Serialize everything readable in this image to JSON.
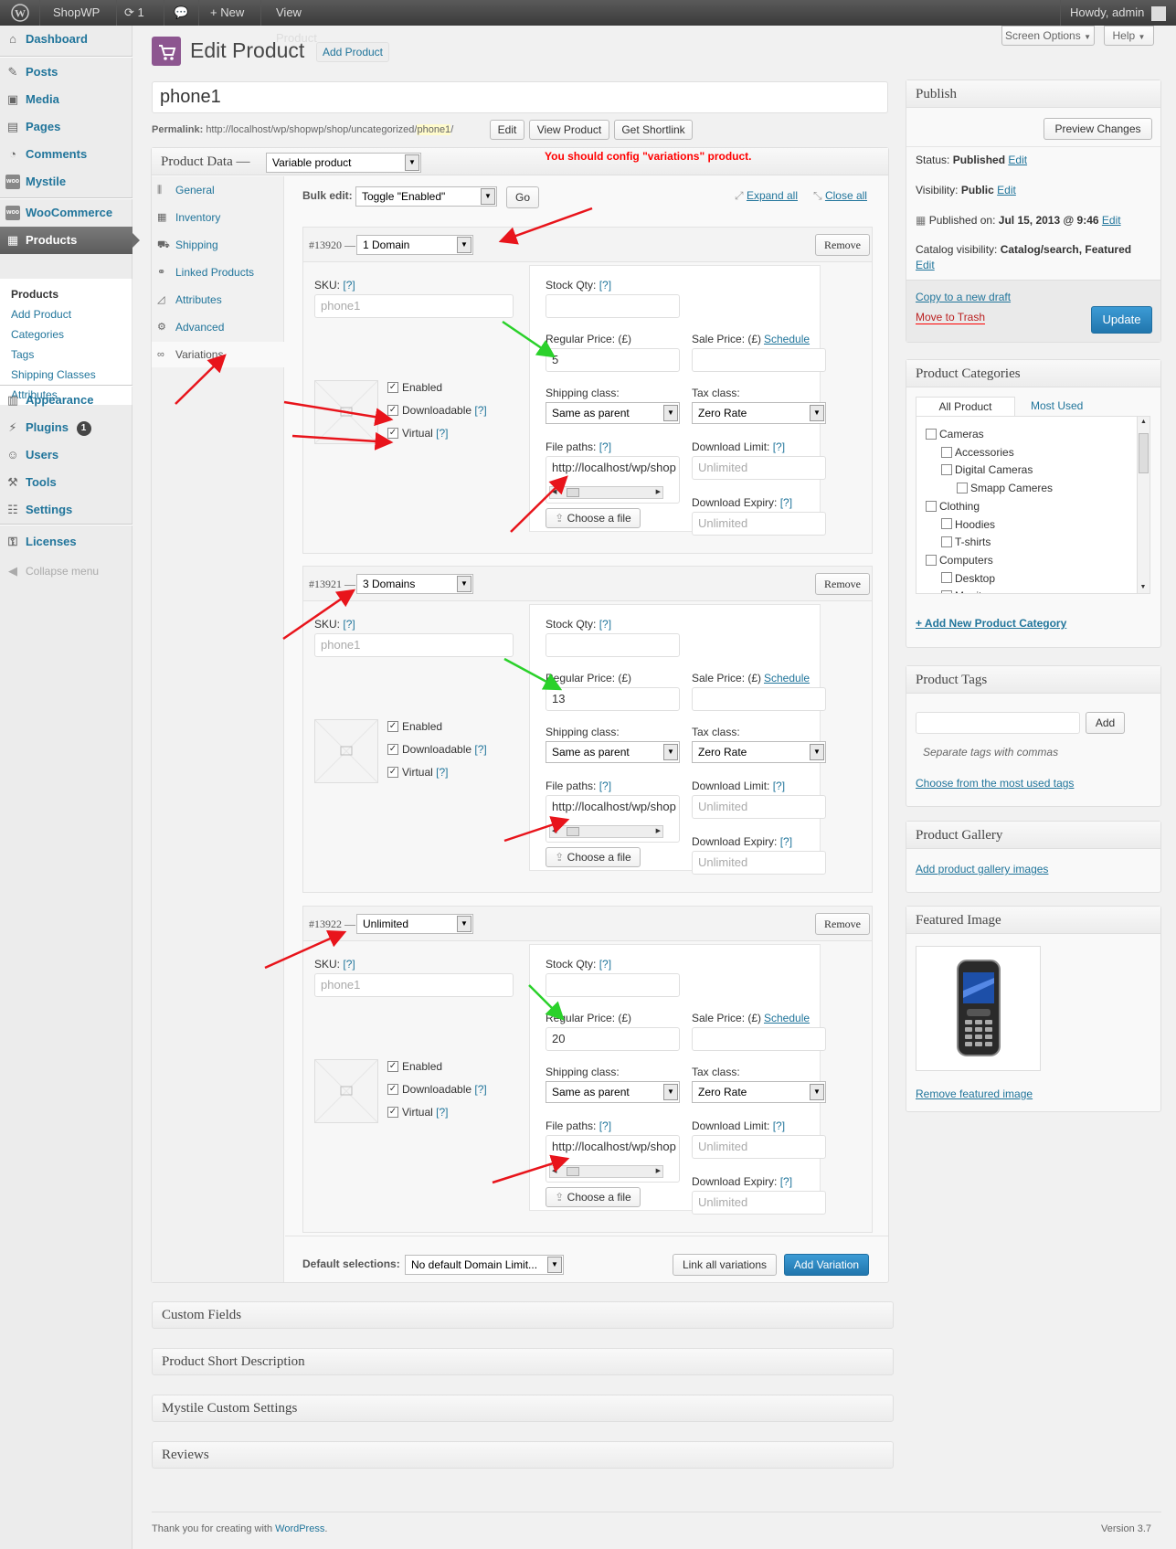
{
  "adminbar": {
    "site_name": "ShopWP",
    "updates_count": "1",
    "new_label": "New",
    "view_product": "View Product",
    "howdy": "Howdy, admin"
  },
  "sidebar": {
    "items": [
      {
        "label": "Dashboard",
        "icon": "dashboard-icon"
      },
      {
        "label": "Posts",
        "icon": "pin-icon"
      },
      {
        "label": "Media",
        "icon": "media-icon"
      },
      {
        "label": "Pages",
        "icon": "page-icon"
      },
      {
        "label": "Comments",
        "icon": "comment-icon"
      },
      {
        "label": "Mystile",
        "icon": "woo-icon"
      },
      {
        "label": "WooCommerce",
        "icon": "woo-icon"
      },
      {
        "label": "Products",
        "icon": "products-icon"
      },
      {
        "label": "Appearance",
        "icon": "appearance-icon"
      },
      {
        "label": "Plugins",
        "icon": "plugin-icon",
        "badge": "1"
      },
      {
        "label": "Users",
        "icon": "users-icon"
      },
      {
        "label": "Tools",
        "icon": "tools-icon"
      },
      {
        "label": "Settings",
        "icon": "settings-icon"
      },
      {
        "label": "Licenses",
        "icon": "key-icon"
      },
      {
        "label": "Collapse menu",
        "icon": "collapse-icon"
      }
    ],
    "submenu": [
      "Products",
      "Add Product",
      "Categories",
      "Tags",
      "Shipping Classes",
      "Attributes"
    ]
  },
  "header": {
    "screen_options": "Screen Options",
    "help": "Help",
    "title": "Edit Product",
    "add_product": "Add Product"
  },
  "product": {
    "title": "phone1",
    "permalink_label": "Permalink:",
    "permalink_base": "http://localhost/wp/shopwp/shop/uncategorized/",
    "permalink_slug": "phone1",
    "permalink_end": "/",
    "edit_btn": "Edit",
    "view_btn": "View Product",
    "shortlink_btn": "Get Shortlink"
  },
  "product_data": {
    "label": "Product Data —",
    "type": "Variable product",
    "notice": "You should config \"variations\" product.",
    "tabs": [
      "General",
      "Inventory",
      "Shipping",
      "Linked Products",
      "Attributes",
      "Advanced",
      "Variations"
    ],
    "bulk_edit_label": "Bulk edit:",
    "bulk_edit_value": "Toggle \"Enabled\"",
    "go": "Go",
    "expand_all": "Expand all",
    "close_all": "Close all",
    "remove": "Remove",
    "labels": {
      "sku": "SKU:",
      "q": "[?]",
      "stock": "Stock Qty:",
      "regular_price": "Regular Price: (£)",
      "sale_price": "Sale Price: (£)",
      "schedule": "Schedule",
      "shipping_class": "Shipping class:",
      "tax_class": "Tax class:",
      "file_paths": "File paths:",
      "download_limit": "Download Limit:",
      "download_expiry": "Download Expiry:",
      "choose_file": "Choose a file",
      "enabled": "Enabled",
      "downloadable": "Downloadable",
      "virtual": "Virtual",
      "dash": "—"
    },
    "variations": [
      {
        "id": "#13920",
        "name": "1 Domain",
        "sku_placeholder": "phone1",
        "regular_price": "5",
        "shipping": "Same as parent",
        "tax": "Zero Rate",
        "file_path": "http://localhost/wp/shop",
        "limit_placeholder": "Unlimited",
        "expiry_placeholder": "Unlimited"
      },
      {
        "id": "#13921",
        "name": "3 Domains",
        "sku_placeholder": "phone1",
        "regular_price": "13",
        "shipping": "Same as parent",
        "tax": "Zero Rate",
        "file_path": "http://localhost/wp/shop",
        "limit_placeholder": "Unlimited",
        "expiry_placeholder": "Unlimited"
      },
      {
        "id": "#13922",
        "name": "Unlimited",
        "sku_placeholder": "phone1",
        "regular_price": "20",
        "shipping": "Same as parent",
        "tax": "Zero Rate",
        "file_path": "http://localhost/wp/shop",
        "limit_placeholder": "Unlimited",
        "expiry_placeholder": "Unlimited"
      }
    ],
    "default_selections_label": "Default selections:",
    "default_selections_value": "No default Domain Limit...",
    "link_all": "Link all variations",
    "add_variation": "Add Variation"
  },
  "collapsed_boxes": [
    "Custom Fields",
    "Product Short Description",
    "Mystile Custom Settings",
    "Reviews"
  ],
  "publish": {
    "title": "Publish",
    "preview": "Preview Changes",
    "status_label": "Status:",
    "status_value": "Published",
    "visibility_label": "Visibility:",
    "visibility_value": "Public",
    "published_on_label": "Published on:",
    "published_on_value": "Jul 15, 2013 @ 9:46",
    "catalog_label": "Catalog visibility:",
    "catalog_value": "Catalog/search, Featured",
    "edit": "Edit",
    "copy_draft": "Copy to a new draft",
    "trash": "Move to Trash",
    "update": "Update"
  },
  "categories": {
    "title": "Product Categories",
    "tab_all": "All Product Categories",
    "tab_used": "Most Used",
    "items": [
      {
        "label": "Cameras",
        "level": 0
      },
      {
        "label": "Accessories",
        "level": 1
      },
      {
        "label": "Digital Cameras",
        "level": 1
      },
      {
        "label": "Smapp Cameres",
        "level": 2
      },
      {
        "label": "Clothing",
        "level": 0
      },
      {
        "label": "Hoodies",
        "level": 1
      },
      {
        "label": "T-shirts",
        "level": 1
      },
      {
        "label": "Computers",
        "level": 0
      },
      {
        "label": "Desktop",
        "level": 1
      },
      {
        "label": "Monitors",
        "level": 1
      }
    ],
    "add_new": "+ Add New Product Category"
  },
  "tags": {
    "title": "Product Tags",
    "add": "Add",
    "hint": "Separate tags with commas",
    "choose": "Choose from the most used tags"
  },
  "gallery": {
    "title": "Product Gallery",
    "add": "Add product gallery images"
  },
  "featured": {
    "title": "Featured Image",
    "remove": "Remove featured image"
  },
  "footer": {
    "thanks": "Thank you for creating with",
    "wordpress": "WordPress",
    "period": ".",
    "version": "Version 3.7"
  },
  "colors": {
    "accent": "#21759b",
    "notice": "#ff0000",
    "arrow_red": "#e8141b",
    "arrow_green": "#2ad12a",
    "update_button": "#2e8ac2"
  }
}
